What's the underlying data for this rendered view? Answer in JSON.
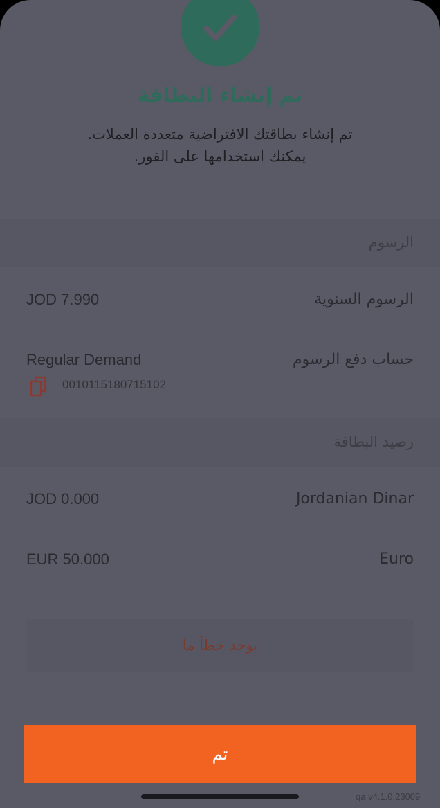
{
  "header": {
    "title": "تم إنشاء البطاقة",
    "subtitle_line1": "تم إنشاء بطاقتك الافتراضية متعددة العملات.",
    "subtitle_line2": "يمكنك استخدامها على الفور."
  },
  "fees": {
    "section_title": "الرسوم",
    "annual_fee_label": "الرسوم السنوية",
    "annual_fee_value": "JOD 7.990",
    "fee_account_label": "حساب دفع الرسوم",
    "fee_account_name": "Regular Demand",
    "fee_account_number": "0010115180715102"
  },
  "balance": {
    "section_title": "رصيد البطاقة",
    "rows": [
      {
        "currency": "Jordanian Dinar",
        "amount": "JOD 0.000"
      },
      {
        "currency": "Euro",
        "amount": "EUR 50.000"
      }
    ]
  },
  "error_message": "يوجد خطأ ما",
  "done_button": "تم",
  "version_text": "qa v4.1.0.23009",
  "colors": {
    "background": "#5a5a66",
    "accent_green": "#2f6b5a",
    "button_orange": "#f26322",
    "error_text": "#7a3a30"
  },
  "icons": {
    "success": "checkmark-icon",
    "copy": "copy-icon"
  }
}
